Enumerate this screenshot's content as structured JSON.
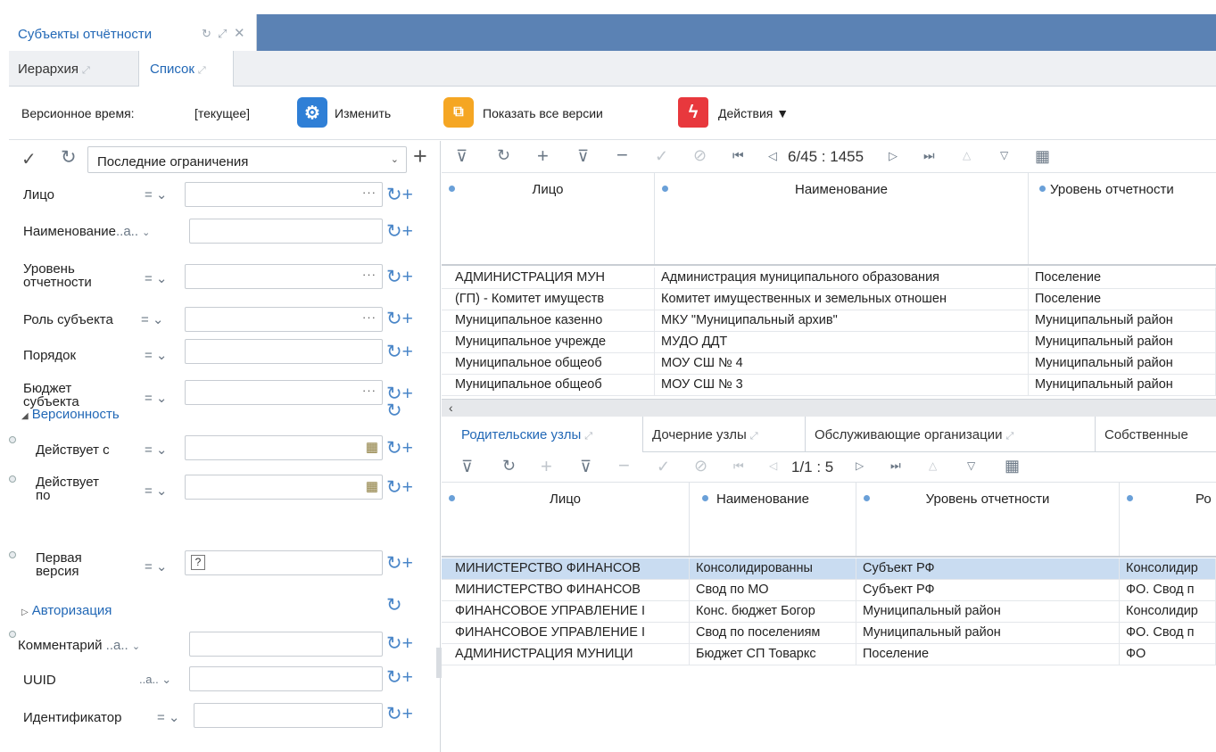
{
  "window": {
    "doc_tab": "Субъекты отчётности",
    "subtabs": [
      "Иерархия",
      "Список"
    ],
    "active_subtab": "Список"
  },
  "toolbar": {
    "version_time_label": "Версионное время:",
    "version_time_value": "[текущее]",
    "change_label": "Изменить",
    "show_versions_label": "Показать все версии",
    "actions_label": "Действия ▼",
    "colors": {
      "change_icon": "#2f7fd6",
      "versions_icon": "#f5a623",
      "actions_icon": "#e8383d"
    }
  },
  "filter": {
    "preset": "Последние ограничения",
    "fields": [
      {
        "label": "Лицо",
        "op": "=",
        "value": ""
      },
      {
        "label": "Наименование",
        "op": "..a..",
        "value": ""
      },
      {
        "label": "Уровень отчетности",
        "op": "=",
        "value": ""
      },
      {
        "label": "Роль субъекта",
        "op": "=",
        "value": ""
      },
      {
        "label": "Порядок",
        "op": "=",
        "value": ""
      },
      {
        "label": "Бюджет субъекта",
        "op": "=",
        "value": ""
      }
    ],
    "section_versioning": "Версионность",
    "versioning_fields": [
      {
        "label": "Действует с",
        "op": "=",
        "value": ""
      },
      {
        "label": "Действует по",
        "op": "=",
        "value": ""
      },
      {
        "label": "Первая версия",
        "op": "=",
        "value": "?"
      }
    ],
    "section_auth": "Авторизация",
    "extra_fields": [
      {
        "label": "Комментарий",
        "op": "..a..",
        "value": ""
      },
      {
        "label": "UUID",
        "op": "..a..",
        "value": ""
      },
      {
        "label": "Идентификатор",
        "op": "=",
        "value": ""
      }
    ]
  },
  "main_grid": {
    "pager": "6/45 : 1455",
    "columns": [
      "Лицо",
      "Наименование",
      "Уровень отчетности"
    ],
    "rows": [
      [
        "АДМИНИСТРАЦИЯ МУН",
        "Администрация муниципального образования",
        "Поселение"
      ],
      [
        "(ГП) - Комитет имуществ",
        "Комитет имущественных и земельных отношен",
        "Поселение"
      ],
      [
        "Муниципальное казенно",
        "МКУ \"Муниципальный архив\"",
        "Муниципальный район"
      ],
      [
        "Муниципальное учрежде",
        "МУДО ДДТ",
        "Муниципальный район"
      ],
      [
        "Муниципальное общеоб",
        "МОУ СШ № 4",
        "Муниципальный район"
      ],
      [
        "Муниципальное общеоб",
        "МОУ СШ № 3",
        "Муниципальный район"
      ]
    ]
  },
  "bottom": {
    "tabs": [
      "Родительские узлы",
      "Дочерние узлы",
      "Обслуживающие организации",
      "Собственные"
    ],
    "active_tab": "Родительские узлы",
    "pager": "1/1 : 5",
    "columns": [
      "Лицо",
      "Наименование",
      "Уровень отчетности",
      "Ро"
    ],
    "rows": [
      [
        "МИНИСТЕРСТВО ФИНАНСОВ",
        "Консолидированны",
        "Субъект РФ",
        "Консолидир"
      ],
      [
        "МИНИСТЕРСТВО ФИНАНСОВ",
        "Свод по МО",
        "Субъект РФ",
        "ФО. Свод п"
      ],
      [
        "ФИНАНСОВОЕ УПРАВЛЕНИЕ I",
        "Конс. бюджет Богор",
        "Муниципальный район",
        "Консолидир"
      ],
      [
        "ФИНАНСОВОЕ УПРАВЛЕНИЕ I",
        "Свод по поселениям",
        "Муниципальный район",
        "ФО. Свод п"
      ],
      [
        "АДМИНИСТРАЦИЯ МУНИЦИ",
        "Бюджет СП Товаркс",
        "Поселение",
        "ФО"
      ]
    ],
    "selected_row": 0
  }
}
